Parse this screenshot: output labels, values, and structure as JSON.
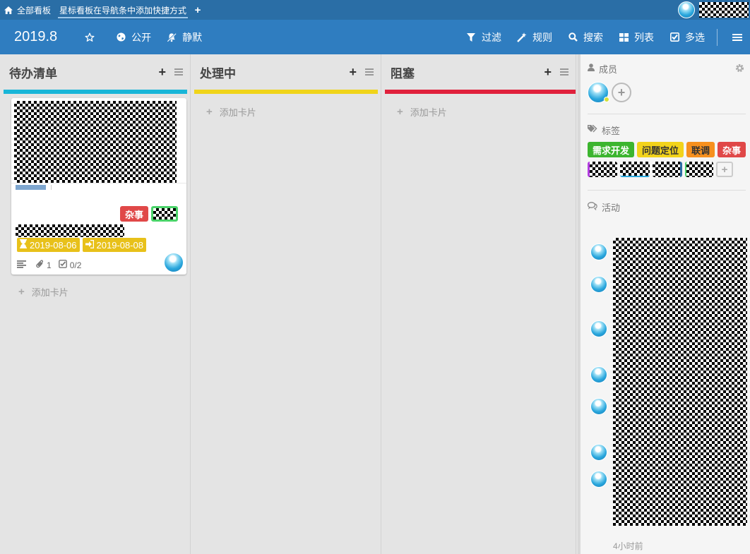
{
  "topbar": {
    "home_label": "全部看板",
    "active_tab": "星标看板在导航条中添加快捷方式",
    "add_label": "+"
  },
  "header": {
    "board_title": "2019.8",
    "visibility_label": "公开",
    "mute_label": "静默",
    "filter_label": "过滤",
    "rules_label": "规则",
    "search_label": "搜索",
    "list_view_label": "列表",
    "multiselect_label": "多选"
  },
  "lists": [
    {
      "title": "待办清单",
      "color": "#19b6d8",
      "add_card_label": "添加卡片"
    },
    {
      "title": "处理中",
      "color": "#f0d41a",
      "add_card_label": "添加卡片"
    },
    {
      "title": "阻塞",
      "color": "#e0213c",
      "add_card_label": "添加卡片"
    }
  ],
  "card": {
    "label": "杂事",
    "label_color": "#e04848",
    "start_date": "2019-08-06",
    "due_date": "2019-08-08",
    "attachments_count": "1",
    "checklist": "0/2",
    "date_color": "#e8c11a"
  },
  "sidebar": {
    "members_title": "成员",
    "labels_title": "标签",
    "labels": [
      {
        "text": "需求开发",
        "color": "#3cb52f"
      },
      {
        "text": "问题定位",
        "color": "#f2d31b"
      },
      {
        "text": "联调",
        "color": "#f7901e"
      },
      {
        "text": "杂事",
        "color": "#e04848"
      }
    ],
    "activity_title": "活动",
    "activity_time": "4小时前"
  },
  "icons": {
    "home": "home-icon",
    "star": "star-icon",
    "globe": "globe-icon",
    "mute": "bell-slash-icon",
    "filter": "filter-icon",
    "rules": "magic-wand-icon",
    "search": "search-icon",
    "list": "th-large-icon",
    "multiselect": "check-square-icon",
    "menu": "hamburger-icon"
  }
}
